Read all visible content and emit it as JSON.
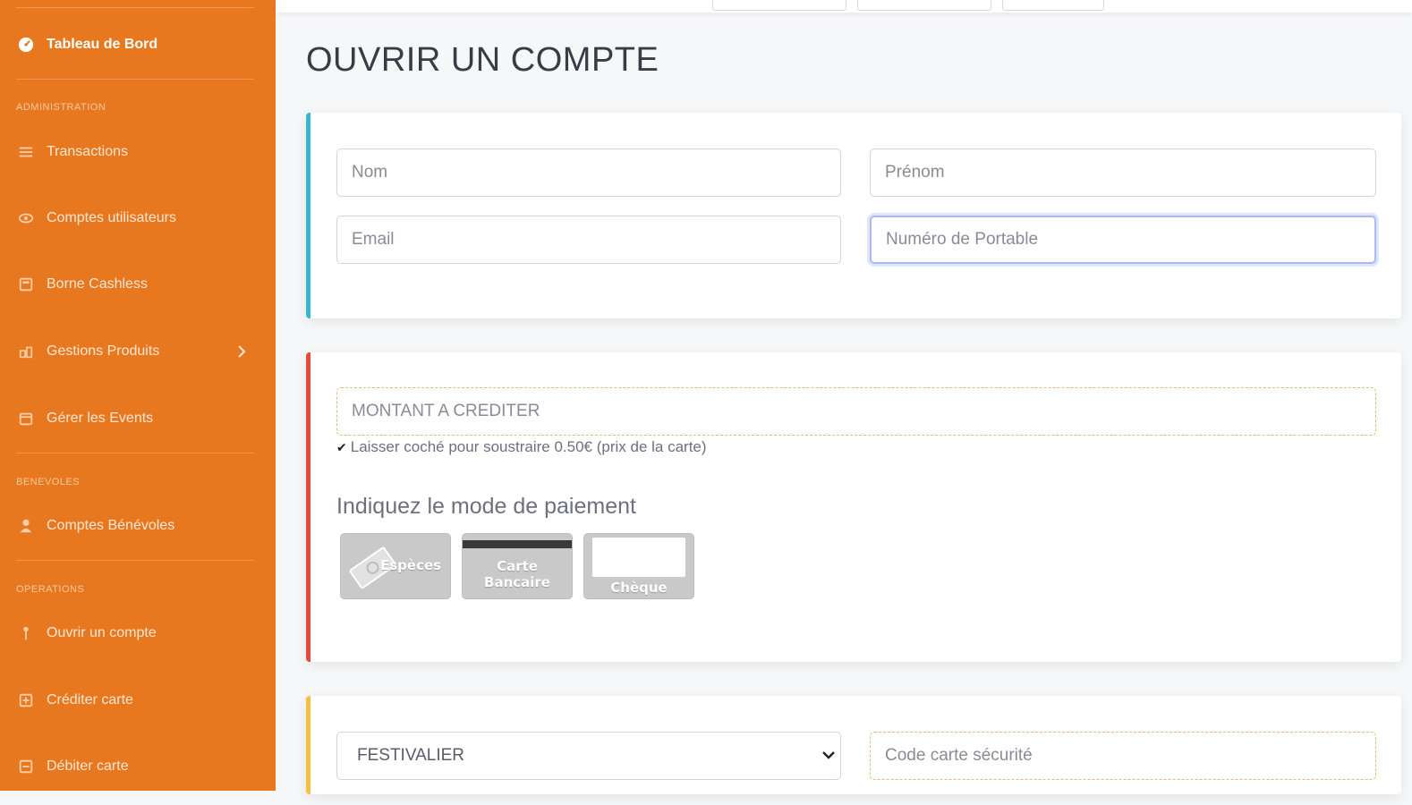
{
  "sidebar": {
    "brand_label": "Tableau de Bord",
    "headings": {
      "administration": "ADMINISTRATION",
      "benevoles": "BENEVOLES",
      "operations": "OPERATIONS"
    },
    "items": {
      "transactions": "Transactions",
      "comptes_utilisateurs": "Comptes utilisateurs",
      "borne_cashless": "Borne Cashless",
      "gestions_produits": "Gestions Produits",
      "gerer_events": "Gérer les Events",
      "comptes_benevoles": "Comptes Bénévoles",
      "ouvrir_compte": "Ouvrir un compte",
      "crediter_carte": "Créditer carte",
      "debiter_carte": "Débiter carte"
    }
  },
  "page": {
    "title": "OUVRIR UN COMPTE"
  },
  "identity_form": {
    "nom_placeholder": "Nom",
    "prenom_placeholder": "Prénom",
    "email_placeholder": "Email",
    "portable_placeholder": "Numéro de Portable"
  },
  "credit_form": {
    "montant_placeholder": "MONTANT A CREDITER",
    "checkbox_note": "Laisser coché pour soustraire 0.50€ (prix de la carte)",
    "payment_heading": "Indiquez le mode de paiement",
    "payment_methods": {
      "especes": "Espèces",
      "carte_bancaire": "Carte Bancaire",
      "cheque": "Chèque"
    }
  },
  "card_form": {
    "profile_selected": "FESTIVALIER",
    "code_placeholder": "Code carte sécurité"
  },
  "colors": {
    "sidebar_bg": "#e8781f",
    "info_accent": "#36b9cc",
    "danger_accent": "#e74a3b",
    "warning_accent": "#f6c23e"
  }
}
